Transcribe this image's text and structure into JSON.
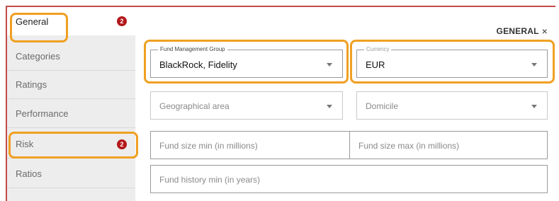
{
  "sidebar": {
    "items": [
      {
        "label": "General",
        "badge": "2"
      },
      {
        "label": "Categories"
      },
      {
        "label": "Ratings"
      },
      {
        "label": "Performance"
      },
      {
        "label": "Risk",
        "badge": "2"
      },
      {
        "label": "Ratios"
      }
    ]
  },
  "panel": {
    "title": "GENERAL",
    "close_icon": "×"
  },
  "fields": {
    "fund_management_group": {
      "label": "Fund Management Group",
      "value": "BlackRock, Fidelity"
    },
    "currency": {
      "label": "Currency",
      "value": "EUR"
    },
    "geographical_area": {
      "placeholder": "Geographical area"
    },
    "domicile": {
      "placeholder": "Domicile"
    },
    "fund_size_min": {
      "placeholder": "Fund size min (in millions)"
    },
    "fund_size_max": {
      "placeholder": "Fund size max (in millions)"
    },
    "fund_history_min": {
      "placeholder": "Fund history min (in years)"
    }
  },
  "colors": {
    "badge": "#b4191c",
    "highlight": "#f0a022",
    "frame_border": "#c44a4a"
  }
}
